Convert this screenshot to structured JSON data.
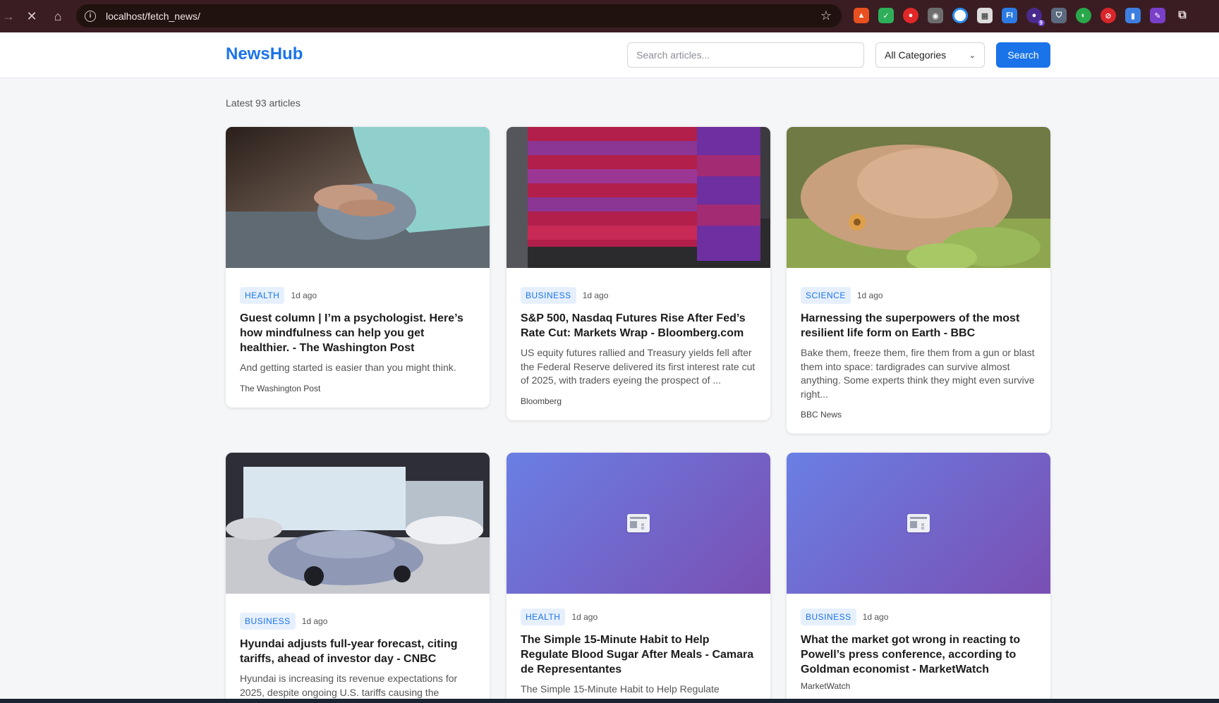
{
  "browser": {
    "url": "localhost/fetch_news/",
    "extension_badge": "9"
  },
  "site": {
    "brand": "NewsHub",
    "search_placeholder": "Search articles...",
    "category_selected": "All Categories",
    "search_label": "Search",
    "count_label": "Latest 93 articles"
  },
  "articles": [
    {
      "category": "HEALTH",
      "ago": "1d ago",
      "title": "Guest column | I’m a psychologist. Here’s how mindfulness can help you get healthier. - The Washington Post",
      "description": "And getting started is easier than you might think.",
      "source": "The Washington Post",
      "image": "meditation-hands-photo"
    },
    {
      "category": "BUSINESS",
      "ago": "1d ago",
      "title": "S&P 500, Nasdaq Futures Rise After Fed’s Rate Cut: Markets Wrap - Bloomberg.com",
      "description": "US equity futures rallied and Treasury yields fell after the Federal Reserve delivered its first interest rate cut of 2025, with traders eyeing the prospect of ...",
      "source": "Bloomberg",
      "image": "stock-ticker-cube-photo"
    },
    {
      "category": "SCIENCE",
      "ago": "1d ago",
      "title": "Harnessing the superpowers of the most resilient life form on Earth - BBC",
      "description": "Bake them, freeze them, fire them from a gun or blast them into space: tardigrades can survive almost anything. Some experts think they might even survive right...",
      "source": "BBC News",
      "image": "tardigrade-photo"
    },
    {
      "category": "BUSINESS",
      "ago": "1d ago",
      "title": "Hyundai adjusts full-year forecast, citing tariffs, ahead of investor day - CNBC",
      "description": "Hyundai is increasing its revenue expectations for 2025, despite ongoing U.S. tariffs causing the",
      "source": "",
      "image": "car-showroom-photo"
    },
    {
      "category": "HEALTH",
      "ago": "1d ago",
      "title": "The Simple 15-Minute Habit to Help Regulate Blood Sugar After Meals - Camara de Representantes",
      "description": "The Simple 15-Minute Habit to Help Regulate",
      "source": "",
      "image": "newspaper-icon"
    },
    {
      "category": "BUSINESS",
      "ago": "1d ago",
      "title": "What the market got wrong in reacting to Powell’s press conference, according to Goldman economist - MarketWatch",
      "description": "",
      "source": "MarketWatch",
      "image": "newspaper-icon"
    }
  ],
  "colors": {
    "brand": "#1a73e8",
    "chrome_bg": "#3a1d22",
    "placeholder_gradient_start": "#6a7fe4",
    "placeholder_gradient_end": "#7a4fb3"
  }
}
